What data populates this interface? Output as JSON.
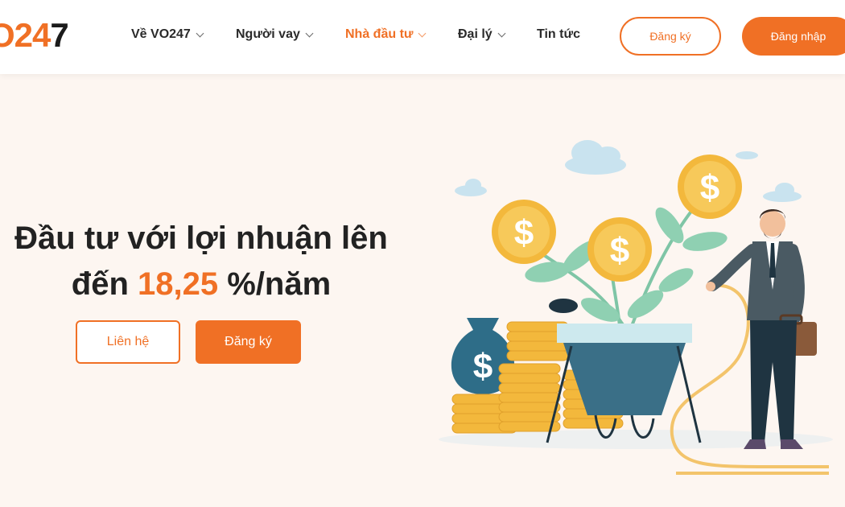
{
  "header": {
    "logo": {
      "prefix": "O",
      "number": "24",
      "suffix": "7"
    },
    "nav": [
      {
        "label": "Về VO247",
        "has_dropdown": true,
        "active": false
      },
      {
        "label": "Người vay",
        "has_dropdown": true,
        "active": false
      },
      {
        "label": "Nhà đầu tư",
        "has_dropdown": true,
        "active": true
      },
      {
        "label": "Đại lý",
        "has_dropdown": true,
        "active": false
      },
      {
        "label": "Tin tức",
        "has_dropdown": false,
        "active": false
      }
    ],
    "register_label": "Đăng ký",
    "login_label": "Đăng nhập"
  },
  "hero": {
    "title_line1": "Đầu tư với lợi nhuận lên",
    "title_line2_prefix": "đến ",
    "rate": "18,25",
    "title_line2_suffix": " %/năm",
    "contact_label": "Liên hệ",
    "register_label": "Đăng ký",
    "illustration": "investor-watering-money-plant"
  },
  "colors": {
    "accent": "#f07025",
    "background": "#fdf6f1",
    "text": "#222222",
    "coin": "#f3b83c",
    "leaf": "#7fc5a6",
    "pot": "#3a6f87"
  }
}
